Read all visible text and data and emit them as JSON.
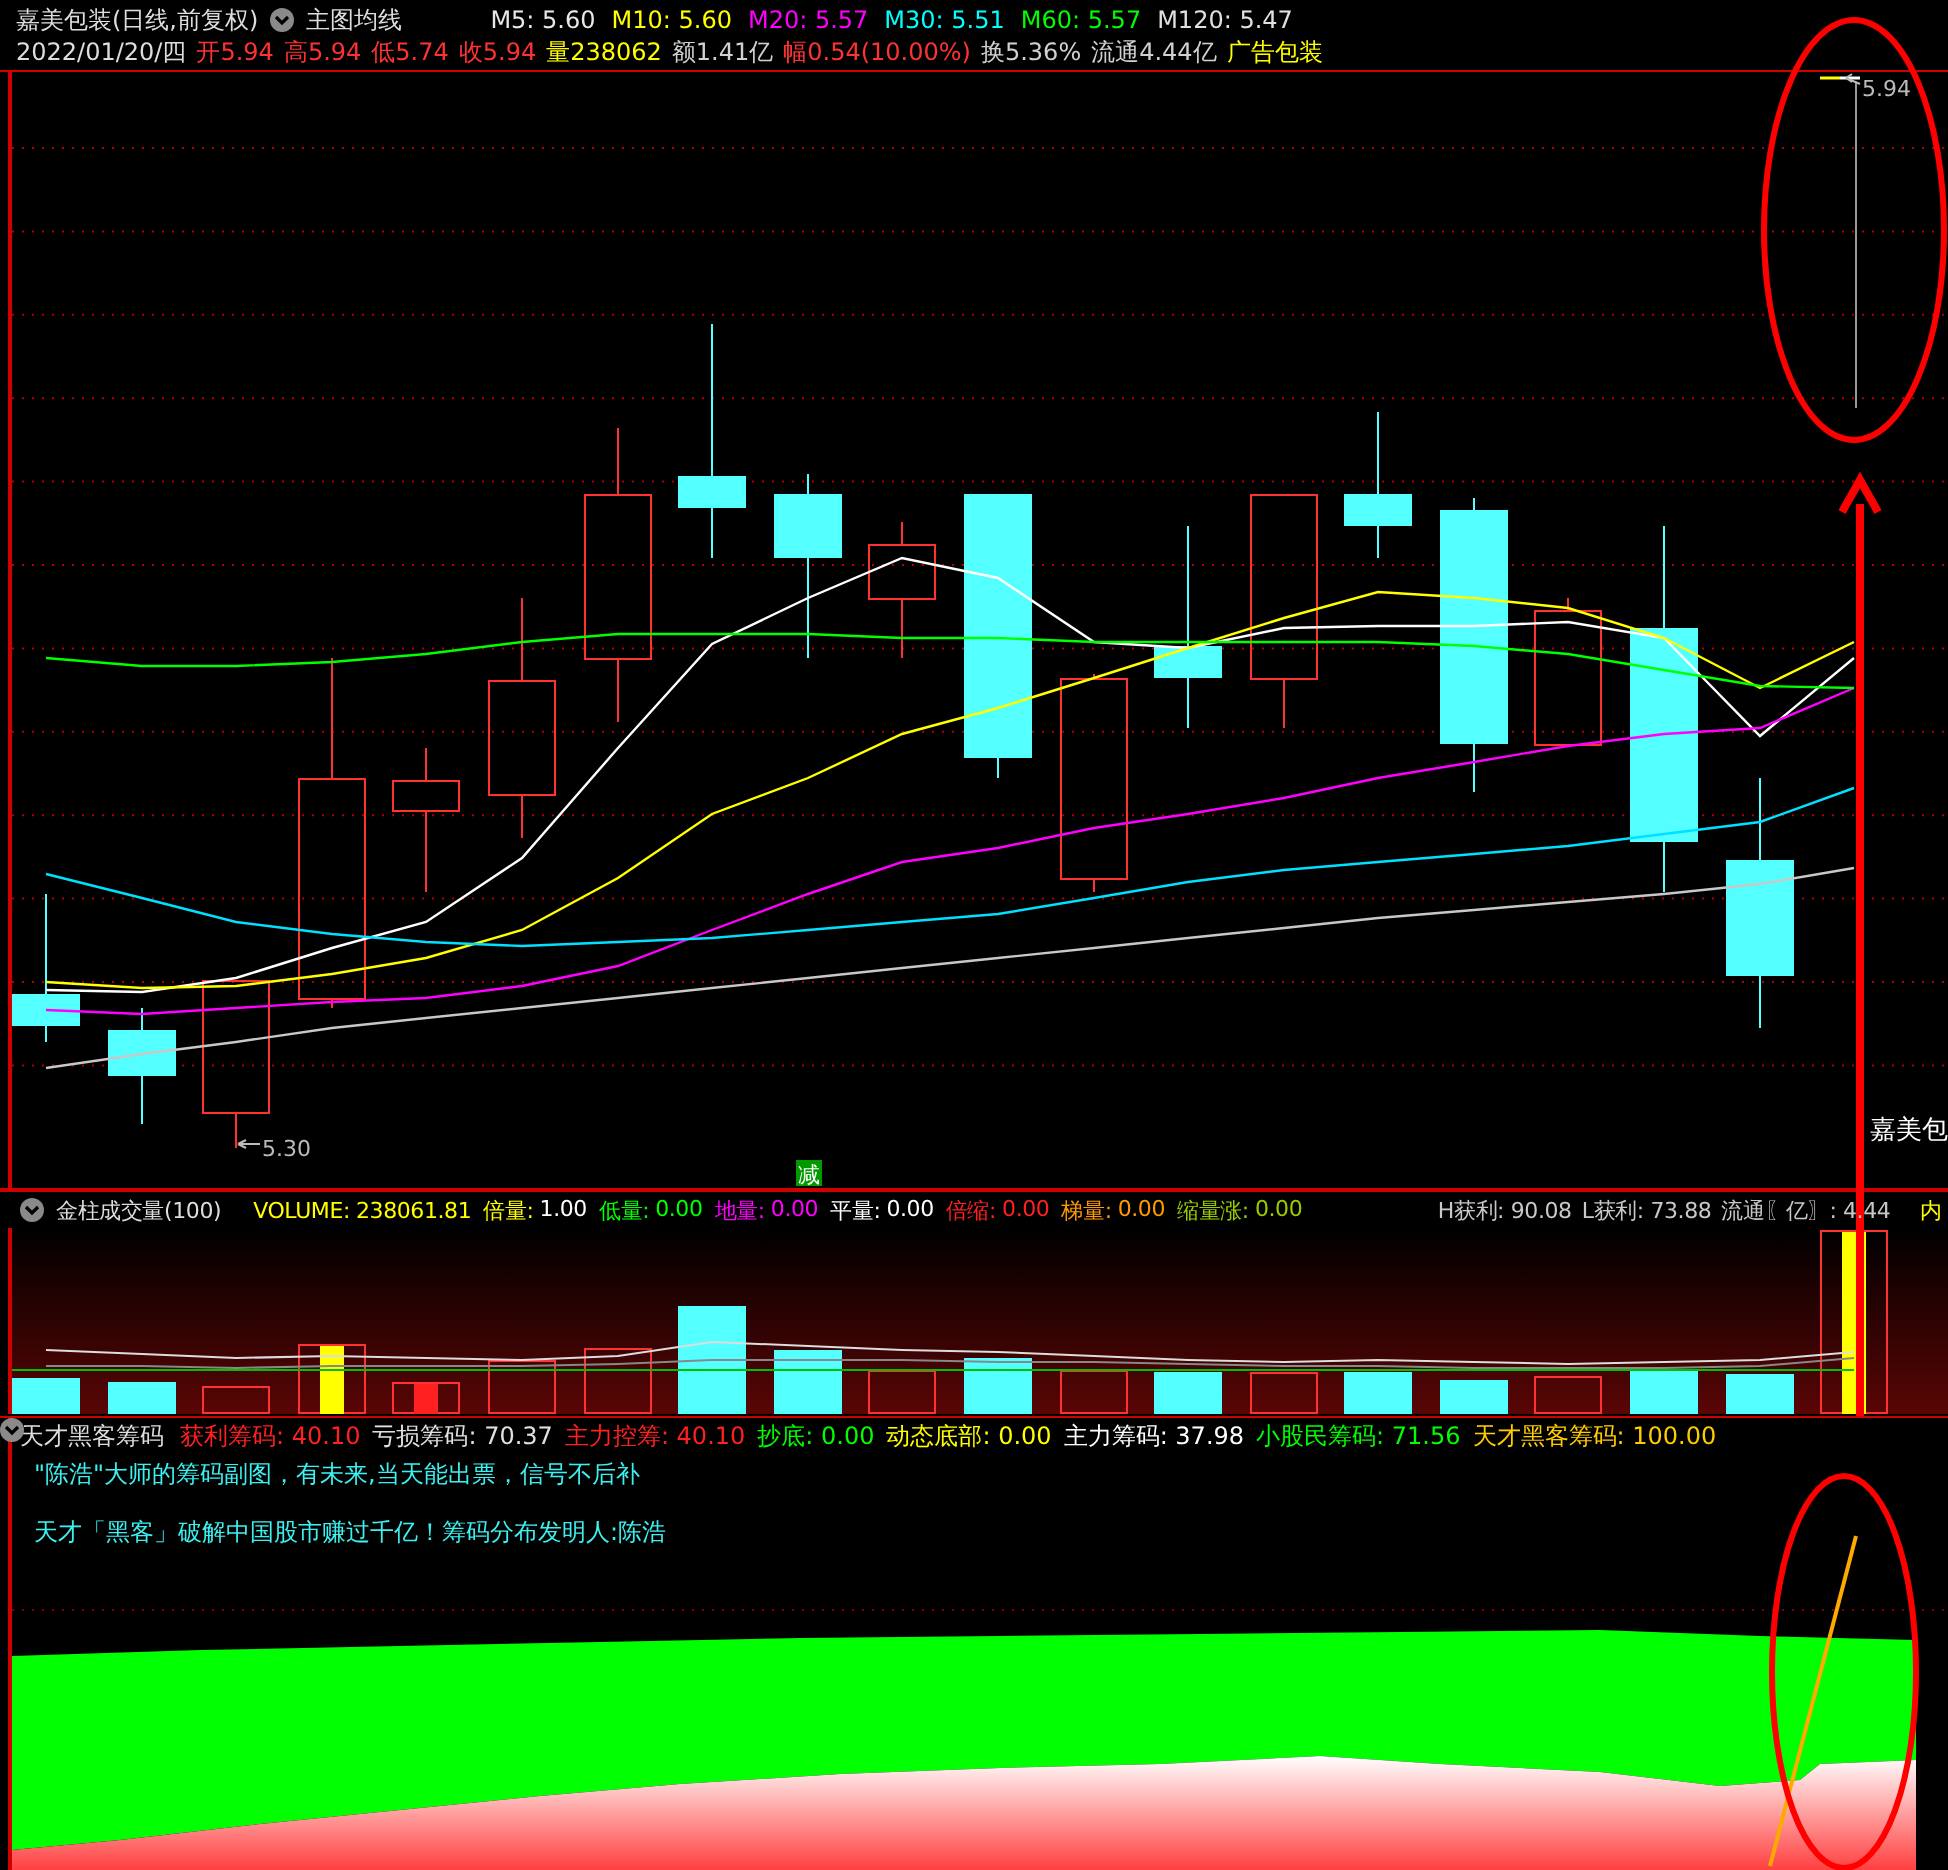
{
  "quote_header": {
    "title": "嘉美包装(日线,前复权)",
    "indicator": "主图均线",
    "moving_averages": [
      {
        "text": "M5: 5.60",
        "color": "#e8e8e8"
      },
      {
        "text": "M10: 5.60",
        "color": "#ffff00"
      },
      {
        "text": "M20: 5.57",
        "color": "#ff00ff"
      },
      {
        "text": "M30: 5.51",
        "color": "#00ffff"
      },
      {
        "text": "M60: 5.57",
        "color": "#00ff00"
      },
      {
        "text": "M120: 5.47",
        "color": "#e0e0e0"
      }
    ],
    "date": "2022/01/20/四",
    "fields": [
      {
        "text": "开5.94",
        "color": "#ff3232"
      },
      {
        "text": "高5.94",
        "color": "#ff3232"
      },
      {
        "text": "低5.74",
        "color": "#ff3232"
      },
      {
        "text": "收5.94",
        "color": "#ff3232"
      },
      {
        "text": "量238062",
        "color": "#ffff00"
      },
      {
        "text": "额1.41亿",
        "color": "#d0d0d0"
      },
      {
        "text": "幅0.54(10.00%)",
        "color": "#ff3232"
      },
      {
        "text": "换5.36%",
        "color": "#d0d0d0"
      },
      {
        "text": "流通4.44亿",
        "color": "#d0d0d0"
      },
      {
        "text": "广告包装",
        "color": "#ffff00"
      }
    ]
  },
  "price_chart": {
    "high_label": "5.94",
    "low_label": "5.30",
    "signal_badge": "减",
    "stock_label": "嘉美包"
  },
  "volume_panel": {
    "title": "金柱成交量(100)",
    "values": [
      {
        "label": "VOLUME:",
        "color": "#ffff00",
        "value": {
          "text": "238061.81",
          "color": "#ffff00"
        }
      },
      {
        "label": "倍量:",
        "color": "#ffff00",
        "value": {
          "text": "1.00",
          "color": "#ffffff"
        }
      },
      {
        "label": "低量:",
        "color": "#00ff00",
        "value": {
          "text": "0.00",
          "color": "#00ff00"
        }
      },
      {
        "label": "地量:",
        "color": "#ff00ff",
        "value": {
          "text": "0.00",
          "color": "#ff00ff"
        }
      },
      {
        "label": "平量:",
        "color": "#ffffff",
        "value": {
          "text": "0.00",
          "color": "#ffffff"
        }
      },
      {
        "label": "倍缩:",
        "color": "#ff2020",
        "value": {
          "text": "0.00",
          "color": "#ff2020"
        }
      },
      {
        "label": "梯量:",
        "color": "#ff9900",
        "value": {
          "text": "0.00",
          "color": "#ff9900"
        }
      },
      {
        "label": "缩量涨:",
        "color": "#99cc00",
        "value": {
          "text": "0.00",
          "color": "#99cc00"
        }
      }
    ],
    "right_values": [
      {
        "text": "H获利: 90.08",
        "color": "#c8c8c8"
      },
      {
        "text": "L获利: 73.88",
        "color": "#c8c8c8"
      },
      {
        "text": "流通〖亿〗: 4.44",
        "color": "#c8c8c8"
      },
      {
        "text": "内",
        "color": "#ffff00"
      }
    ]
  },
  "chip_panel": {
    "title": "天才黑客筹码",
    "values": [
      {
        "text": "获利筹码: 40.10",
        "color": "#ff2020"
      },
      {
        "text": "亏损筹码: 70.37",
        "color": "#e0e0e0"
      },
      {
        "text": "主力控筹: 40.10",
        "color": "#ff2020"
      },
      {
        "text": "抄底: 0.00",
        "color": "#00ff00"
      },
      {
        "text": "动态底部: 0.00",
        "color": "#ffff00"
      },
      {
        "text": "主力筹码: 37.98",
        "color": "#ffffff"
      },
      {
        "text": "小股民筹码: 71.56",
        "color": "#00ff00"
      },
      {
        "text": "天才黑客筹码: 100.00",
        "color": "#ffcc00"
      }
    ],
    "notes": [
      "\"陈浩\"大师的筹码副图，有未来,当天能出票，信号不后补",
      "天才「黑客」破解中国股市赚过千亿！筹码分布发明人:陈浩"
    ]
  }
}
